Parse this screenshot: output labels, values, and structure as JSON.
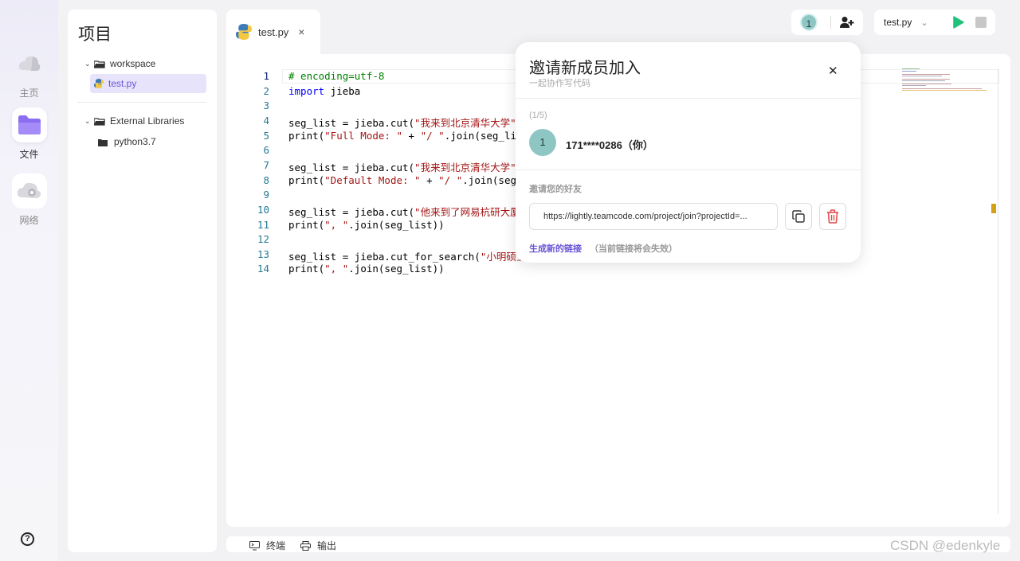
{
  "rail": {
    "items": [
      {
        "label": "主页",
        "icon": "cloud-home-icon"
      },
      {
        "label": "文件",
        "icon": "folder-icon"
      },
      {
        "label": "网络",
        "icon": "network-cloud-icon"
      }
    ],
    "help": "?"
  },
  "project": {
    "title": "项目",
    "tree": [
      {
        "label": "workspace",
        "type": "folder-open"
      },
      {
        "label": "test.py",
        "type": "python-file",
        "selected": true
      },
      {
        "label": "External Libraries",
        "type": "folder-open"
      },
      {
        "label": "python3.7",
        "type": "folder"
      }
    ]
  },
  "editor": {
    "tab": {
      "label": "test.py",
      "close": "×"
    },
    "lines": [
      {
        "n": "1",
        "text": "# encoding=utf-8"
      },
      {
        "n": "2",
        "text": "import jieba"
      },
      {
        "n": "3",
        "text": ""
      },
      {
        "n": "4",
        "text": "seg_list = jieba.cut(\"我来到北京清华大学\""
      },
      {
        "n": "5",
        "text": "print(\"Full Mode: \" + \"/ \".join(seg_lis"
      },
      {
        "n": "6",
        "text": ""
      },
      {
        "n": "7",
        "text": "seg_list = jieba.cut(\"我来到北京清华大学\""
      },
      {
        "n": "8",
        "text": "print(\"Default Mode: \" + \"/ \".join(seg_l"
      },
      {
        "n": "9",
        "text": ""
      },
      {
        "n": "10",
        "text": "seg_list = jieba.cut(\"他来到了网易杭研大厦"
      },
      {
        "n": "11",
        "text": "print(\", \".join(seg_list))"
      },
      {
        "n": "12",
        "text": ""
      },
      {
        "n": "13",
        "text": "seg_list = jieba.cut_for_search(\"小明硕士"
      },
      {
        "n": "14",
        "text": "print(\", \".join(seg_list))"
      }
    ]
  },
  "toolbar": {
    "collaborator_count": "1",
    "file_select": "test.py",
    "colors": {
      "run": "#1fc17b",
      "stop": "#c8c8c8"
    }
  },
  "bottom": {
    "terminal": "终端",
    "output": "输出"
  },
  "watermark": "CSDN @edenkyle",
  "invite": {
    "title": "邀请新成员加入",
    "subtitle": "一起协作写代码",
    "count": "(1/5)",
    "member_avatar": "1",
    "member_name": "171****0286（你）",
    "invite_label": "邀请您的好友",
    "link": "https://lightly.teamcode.com/project/join?projectId=...",
    "generate": "生成新的链接",
    "note": "（当前链接将会失效）",
    "colors": {
      "accent": "#6a56d6",
      "danger": "#e24b4b",
      "avatar": "#8ec6c4"
    }
  }
}
